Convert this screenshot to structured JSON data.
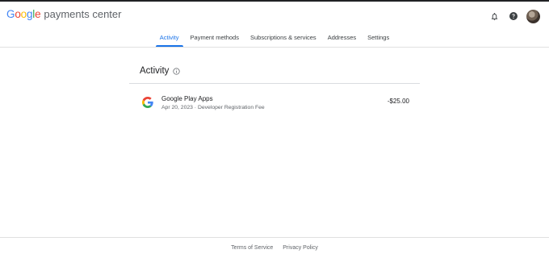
{
  "header": {
    "logo_letters": [
      {
        "ch": "G",
        "color": "#4285F4"
      },
      {
        "ch": "o",
        "color": "#EA4335"
      },
      {
        "ch": "o",
        "color": "#FBBC05"
      },
      {
        "ch": "g",
        "color": "#4285F4"
      },
      {
        "ch": "l",
        "color": "#34A853"
      },
      {
        "ch": "e",
        "color": "#EA4335"
      }
    ],
    "product": "payments center",
    "icons": [
      "bell-icon",
      "help-icon",
      "avatar"
    ]
  },
  "tabs": [
    {
      "label": "Activity",
      "active": true
    },
    {
      "label": "Payment methods",
      "active": false
    },
    {
      "label": "Subscriptions & services",
      "active": false
    },
    {
      "label": "Addresses",
      "active": false
    },
    {
      "label": "Settings",
      "active": false
    }
  ],
  "activity": {
    "title": "Activity",
    "info_icon": "info-icon",
    "transactions": [
      {
        "icon": "google-g-icon",
        "title": "Google Play Apps",
        "subtitle": "Apr 20, 2023 · Developer Registration Fee",
        "amount": "-$25.00"
      }
    ]
  },
  "footer": {
    "terms": "Terms of Service",
    "privacy": "Privacy Policy"
  },
  "colors": {
    "accent": "#1a73e8",
    "text": "#202124",
    "muted": "#5f6368",
    "divider": "#e0e0e0"
  }
}
